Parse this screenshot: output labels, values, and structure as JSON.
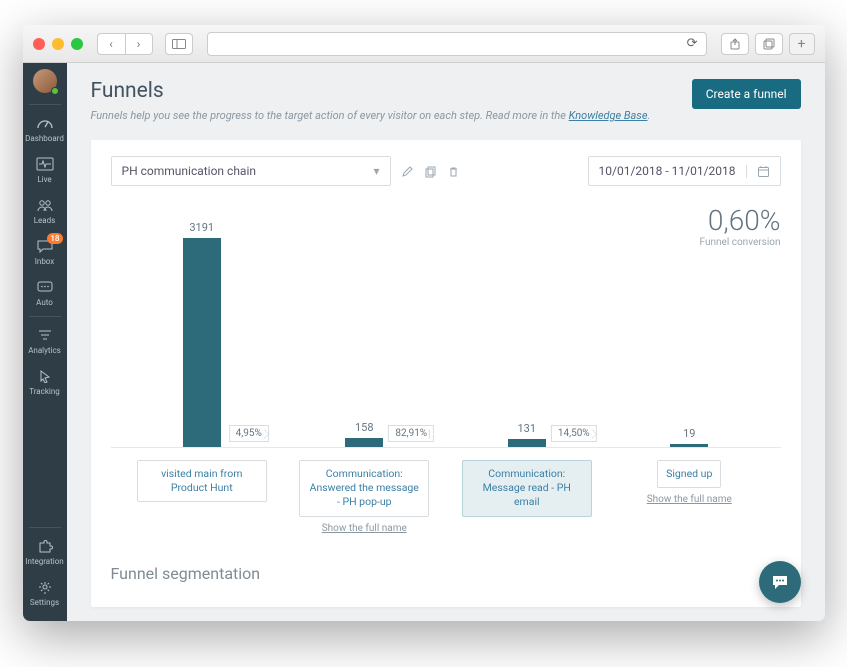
{
  "sidebar": {
    "items": [
      {
        "label": "Dashboard"
      },
      {
        "label": "Live"
      },
      {
        "label": "Leads"
      },
      {
        "label": "Inbox",
        "badge": "18"
      },
      {
        "label": "Auto"
      },
      {
        "label": "Analytics"
      },
      {
        "label": "Tracking"
      }
    ],
    "bottom": [
      {
        "label": "Integration"
      },
      {
        "label": "Settings"
      }
    ]
  },
  "header": {
    "title": "Funnels",
    "desc": "Funnels help you see the progress to the target action of every visitor on each step. Read more in the ",
    "link": "Knowledge Base",
    "linkSuffix": ".",
    "createBtn": "Create a funnel"
  },
  "toolbar": {
    "funnelName": "PH communication chain",
    "dateRange": "10/01/2018 - 11/01/2018"
  },
  "conversion": {
    "value": "0,60%",
    "label": "Funnel conversion"
  },
  "chart_data": {
    "type": "bar",
    "title": "",
    "xlabel": "",
    "ylabel": "",
    "ylim": [
      0,
      3191
    ],
    "categories": [
      "visited main from Product Hunt",
      "Communication: Answered the message - PH pop-up",
      "Communication: Message read - PH email",
      "Signed up"
    ],
    "values": [
      3191,
      158,
      131,
      19
    ],
    "step_rates": [
      "4,95%",
      "82,91%",
      "14,50%"
    ],
    "show_full_name": [
      false,
      true,
      false,
      true
    ],
    "selected_index": 2
  },
  "labels": {
    "showFull": "Show the full name",
    "segTitle": "Funnel segmentation"
  }
}
